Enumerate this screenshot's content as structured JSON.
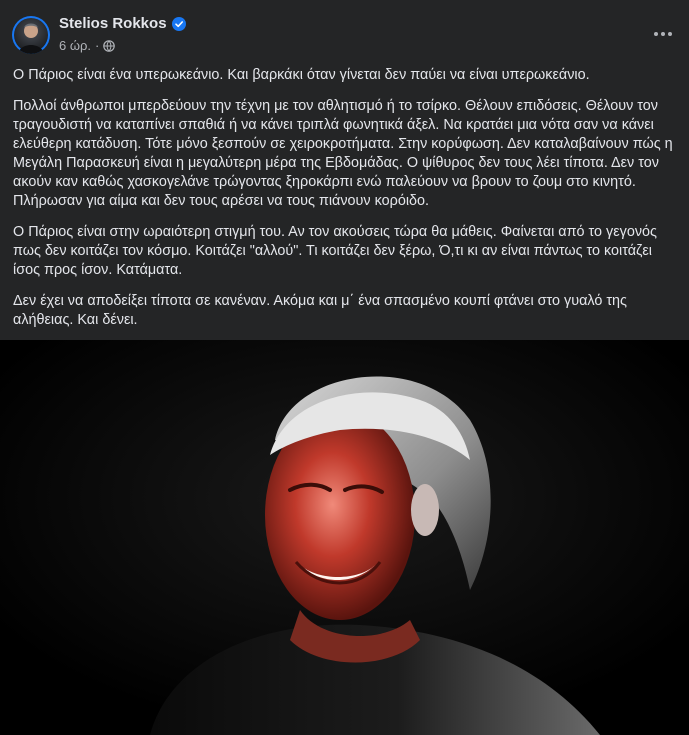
{
  "post": {
    "author": "Stelios Rokkos",
    "verified": true,
    "timestamp": "6 ώρ.",
    "separator": "·",
    "audience_icon": "globe-icon",
    "more_icon": "more-options-icon",
    "paragraphs": [
      "Ο Πάριος είναι ένα υπερωκεάνιο. Και βαρκάκι όταν γίνεται δεν παύει να είναι υπερωκεάνιο.",
      "Πολλοί άνθρωποι μπερδεύουν την τέχνη με τον αθλητισμό ή το τσίρκο. Θέλουν επιδόσεις. Θέλουν τον τραγουδιστή να καταπίνει σπαθιά ή να κάνει τριπλά φωνητικά άξελ. Να κρατάει μια νότα σαν να κάνει ελεύθερη κατάδυση. Τότε μόνο ξεσπούν σε χειροκροτήματα. Στην κορύφωση. Δεν καταλαβαίνουν πώς η Μεγάλη Παρασκευή είναι η μεγαλύτερη μέρα της Εβδομάδας. Ο ψίθυρος δεν τους λέει τίποτα. Δεν τον ακούν καν καθώς χασκογελάνε τρώγοντας ξηροκάρπι ενώ παλεύουν να βρουν το ζουμ στο κινητό. Πλήρωσαν για αίμα και δεν τους αρέσει να τους πιάνουν κορόιδο.",
      "Ο Πάριος είναι στην ωραιότερη στιγμή του. Αν τον ακούσεις τώρα θα μάθεις. Φαίνεται από το γεγονός πως δεν κοιτάζει τον κόσμο. Κοιτάζει \"αλλού\". Τι κοιτάζει δεν ξέρω, Ό,τι κι αν είναι πάντως το κοιτάζει ίσος προς ίσον. Κατάματα.",
      "Δεν έχει να αποδείξει τίποτα σε κανέναν. Ακόμα και μ΄ ένα σπασμένο κουπί φτάνει στο γυαλό της αλήθειας. Και δένει."
    ],
    "photo_description": "photo"
  },
  "colors": {
    "background": "#242526",
    "text": "#e4e6eb",
    "secondary_text": "#b0b3b8",
    "verified_blue": "#1877f2"
  }
}
